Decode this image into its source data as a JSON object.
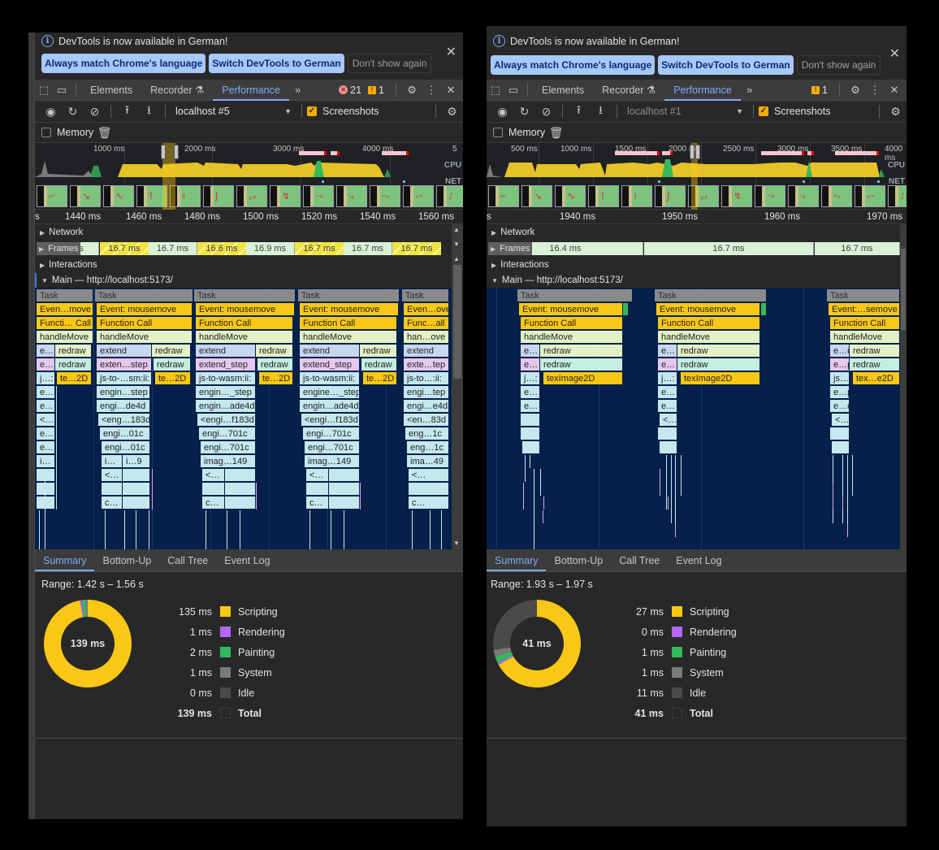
{
  "panels": [
    {
      "id": "left",
      "infobar": {
        "message": "DevTools is now available in German!",
        "buttons": [
          "Always match Chrome's language",
          "Switch DevTools to German"
        ],
        "dismiss": "Don't show again"
      },
      "tabs": [
        "Elements",
        "Recorder",
        "Performance"
      ],
      "active_tab": "Performance",
      "errors": "21",
      "warnings": "1",
      "recording": "localhost #5",
      "screenshots_label": "Screenshots",
      "screenshots_checked": true,
      "memory_label": "Memory",
      "memory_checked": false,
      "overview_ticks": [
        "1000 ms",
        "2000 ms",
        "3000 ms",
        "4000 ms",
        "5"
      ],
      "cpu_label": "CPU",
      "net_label": "NET",
      "ruler_ticks": [
        "s",
        "1440 ms",
        "1460 ms",
        "1480 ms",
        "1500 ms",
        "1520 ms",
        "1540 ms",
        "1560 ms"
      ],
      "tracks": {
        "network": "Network",
        "frames": "Frames",
        "interactions": "Interactions",
        "main": "Main — http://localhost:5173/"
      },
      "frames": [
        "ms",
        "16.7 ms",
        "16.7 ms",
        "16.6 ms",
        "16.9 ms",
        "16.7 ms",
        "16.7 ms",
        "16.7 ms"
      ],
      "flame_labels": {
        "task": "Task",
        "g1": [
          "Even…move",
          "Functi… Call",
          "handleMove",
          "e…",
          "redraw",
          "e…",
          "redraw",
          "j…:",
          "te…2D",
          "e…",
          "e…",
          "<…",
          "e…",
          "e…",
          "i…"
        ],
        "g2": [
          "Event: mousemove",
          "Function Call",
          "handleMove",
          "extend",
          "redraw",
          "exten…step",
          "redraw",
          "js-to-…sm:ii:",
          "te…2D",
          "engin…step",
          "engi…de4d",
          "<eng…183d",
          "engi…01c",
          "engi…01c",
          "i…",
          "i…9",
          "<…",
          "c…"
        ],
        "g3": [
          "Event: mousemove",
          "Function Call",
          "handleMove",
          "extend",
          "redraw",
          "extend_step",
          "redraw",
          "js-to-wasm:ii:",
          "te…2D",
          "engin…_step",
          "engin…ade4d",
          "<engi…f183d",
          "engi…701c",
          "engi…701c",
          "imag…149",
          "<…",
          "c…"
        ],
        "g4": [
          "Event: mousemove",
          "Function Call",
          "handleMove",
          "extend",
          "redraw",
          "extend_step",
          "redraw",
          "js-to-wasm:ii:",
          "te…2D",
          "engine…_step",
          "engin…ade4d",
          "<engi…f183d",
          "engi…701c",
          "engi…701c",
          "imag…149",
          "<…",
          "c…"
        ],
        "g5": [
          "Even…ove",
          "Func…all",
          "han…ove",
          "extend",
          "exte…tep",
          "js-to…:ii:",
          "engi…tep",
          "engi…e4d",
          "<en…83d",
          "eng…1c",
          "eng…1c",
          "ima…49",
          "<…",
          "c…"
        ]
      },
      "bottom_tabs": [
        "Summary",
        "Bottom-Up",
        "Call Tree",
        "Event Log"
      ],
      "summary": {
        "range": "Range: 1.42 s – 1.56 s",
        "total_center": "139 ms",
        "rows": [
          {
            "value": "135 ms",
            "label": "Scripting",
            "color": "#f9c816",
            "ms": 135
          },
          {
            "value": "1 ms",
            "label": "Rendering",
            "color": "#b467f5",
            "ms": 1
          },
          {
            "value": "2 ms",
            "label": "Painting",
            "color": "#33b85b",
            "ms": 2
          },
          {
            "value": "1 ms",
            "label": "System",
            "color": "#7a7a7a",
            "ms": 1
          },
          {
            "value": "0 ms",
            "label": "Idle",
            "color": "#4a4a4a",
            "ms": 0
          }
        ],
        "total": {
          "value": "139 ms",
          "label": "Total"
        }
      }
    },
    {
      "id": "right",
      "infobar": {
        "message": "DevTools is now available in German!",
        "buttons": [
          "Always match Chrome's language",
          "Switch DevTools to German"
        ],
        "dismiss": "Don't show again"
      },
      "tabs": [
        "Elements",
        "Recorder",
        "Performance"
      ],
      "active_tab": "Performance",
      "warnings": "1",
      "recording": "localhost #1",
      "screenshots_label": "Screenshots",
      "screenshots_checked": true,
      "memory_label": "Memory",
      "memory_checked": false,
      "overview_ticks": [
        "500 ms",
        "1000 ms",
        "1500 ms",
        "2000 ms",
        "2500 ms",
        "3000 ms",
        "3500 ms",
        "4000 ms"
      ],
      "cpu_label": "CPU",
      "net_label": "NET",
      "ruler_ticks": [
        "s",
        "1940 ms",
        "1950 ms",
        "1960 ms",
        "1970 ms"
      ],
      "tracks": {
        "network": "Network",
        "frames": "Frames",
        "interactions": "Interactions",
        "main": "Main — http://localhost:5173/"
      },
      "frames": [
        "16.4 ms",
        "16.7 ms",
        "16.7 ms"
      ],
      "flame_labels": {
        "task": "Task",
        "g1": [
          "Event: mousemove",
          "Function Call",
          "handleMove",
          "e…",
          "redraw",
          "e…",
          "redraw",
          "j…:",
          "texImage2D",
          "e…",
          "e…"
        ],
        "g2": [
          "Event: mousemove",
          "Function Call",
          "handleMove",
          "e…",
          "redraw",
          "e…",
          "redraw",
          "j…:",
          "texImage2D",
          "e…",
          "e…",
          "<…"
        ],
        "g3": [
          "Event:…semove",
          "Function Call",
          "handleMove",
          "e…d",
          "redraw",
          "e…p",
          "redraw",
          "js…:",
          "tex…e2D",
          "e…p",
          "e…d",
          "<…"
        ]
      },
      "bottom_tabs": [
        "Summary",
        "Bottom-Up",
        "Call Tree",
        "Event Log"
      ],
      "summary": {
        "range": "Range: 1.93 s – 1.97 s",
        "total_center": "41 ms",
        "rows": [
          {
            "value": "27 ms",
            "label": "Scripting",
            "color": "#f9c816",
            "ms": 27
          },
          {
            "value": "0 ms",
            "label": "Rendering",
            "color": "#b467f5",
            "ms": 0.3
          },
          {
            "value": "1 ms",
            "label": "Painting",
            "color": "#33b85b",
            "ms": 1
          },
          {
            "value": "1 ms",
            "label": "System",
            "color": "#7a7a7a",
            "ms": 1
          },
          {
            "value": "11 ms",
            "label": "Idle",
            "color": "#4a4a4a",
            "ms": 11
          }
        ],
        "total": {
          "value": "41 ms",
          "label": "Total"
        }
      }
    }
  ]
}
